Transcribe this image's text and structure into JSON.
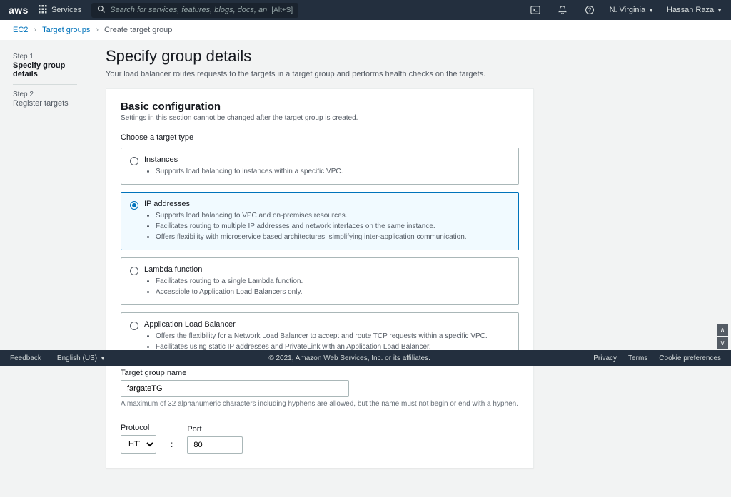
{
  "topnav": {
    "logo": "aws",
    "services": "Services",
    "search_placeholder": "Search for services, features, blogs, docs, and more",
    "search_shortcut": "[Alt+S]",
    "region": "N. Virginia",
    "user": "Hassan Raza"
  },
  "breadcrumb": {
    "items": [
      "EC2",
      "Target groups",
      "Create target group"
    ]
  },
  "steps": [
    {
      "num": "Step 1",
      "label": "Specify group details",
      "active": true
    },
    {
      "num": "Step 2",
      "label": "Register targets",
      "active": false
    }
  ],
  "page": {
    "title": "Specify group details",
    "desc": "Your load balancer routes requests to the targets in a target group and performs health checks on the targets."
  },
  "panel": {
    "title": "Basic configuration",
    "sub": "Settings in this section cannot be changed after the target group is created.",
    "choose_label": "Choose a target type",
    "targets": [
      {
        "title": "Instances",
        "selected": false,
        "bullets": [
          "Supports load balancing to instances within a specific VPC."
        ]
      },
      {
        "title": "IP addresses",
        "selected": true,
        "bullets": [
          "Supports load balancing to VPC and on-premises resources.",
          "Facilitates routing to multiple IP addresses and network interfaces on the same instance.",
          "Offers flexibility with microservice based architectures, simplifying inter-application communication."
        ]
      },
      {
        "title": "Lambda function",
        "selected": false,
        "bullets": [
          "Facilitates routing to a single Lambda function.",
          "Accessible to Application Load Balancers only."
        ]
      },
      {
        "title": "Application Load Balancer",
        "selected": false,
        "bullets": [
          "Offers the flexibility for a Network Load Balancer to accept and route TCP requests within a specific VPC.",
          "Facilitates using static IP addresses and PrivateLink with an Application Load Balancer."
        ]
      }
    ],
    "tg_name_label": "Target group name",
    "tg_name_value": "fargateTG",
    "tg_name_hint": "A maximum of 32 alphanumeric characters including hyphens are allowed, but the name must not begin or end with a hyphen.",
    "protocol_label": "Protocol",
    "protocol_value": "HTTP",
    "port_label": "Port",
    "port_value": "80"
  },
  "footer": {
    "feedback": "Feedback",
    "lang": "English (US)",
    "copy": "© 2021, Amazon Web Services, Inc. or its affiliates.",
    "links": [
      "Privacy",
      "Terms",
      "Cookie preferences"
    ]
  }
}
